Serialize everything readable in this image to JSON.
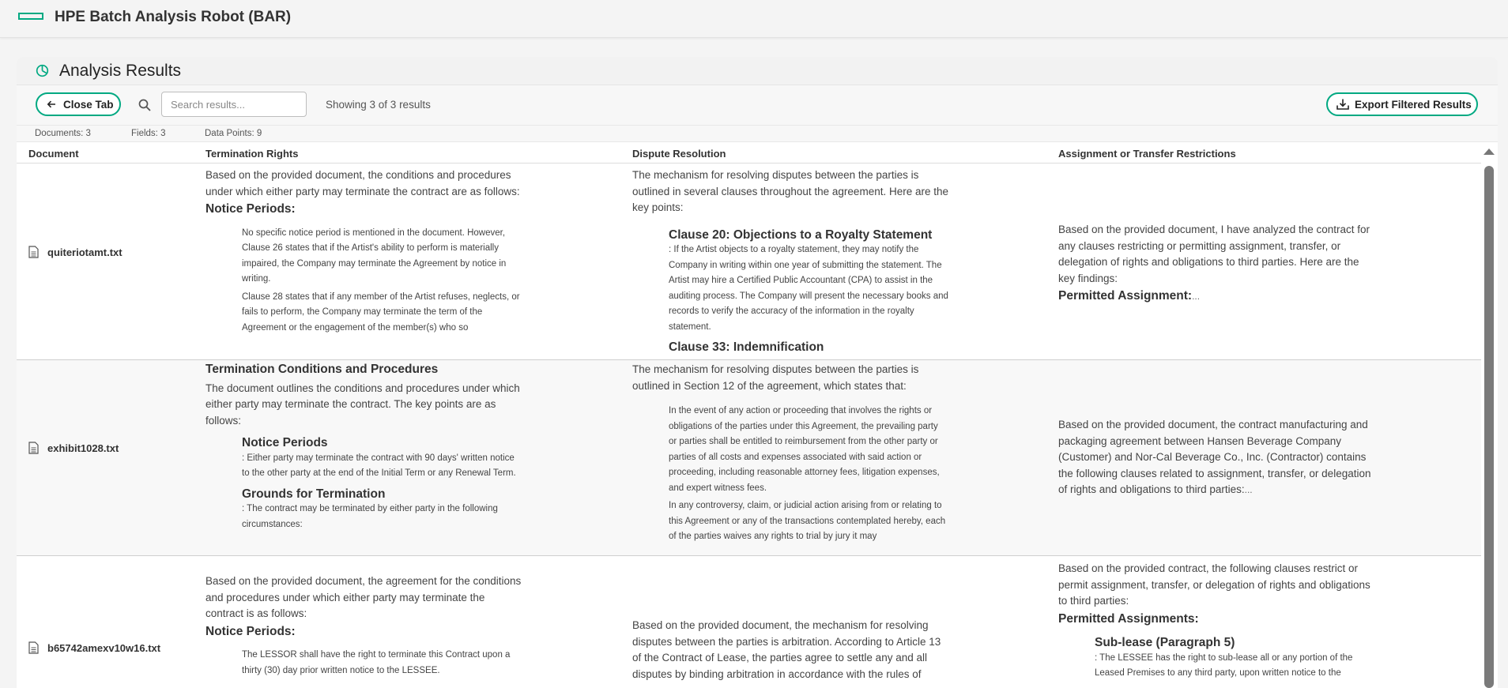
{
  "app": {
    "title": "HPE Batch Analysis Robot (BAR)",
    "accent": "#01a982"
  },
  "panel": {
    "title": "Analysis Results"
  },
  "toolbar": {
    "close_label": "Close Tab",
    "search_placeholder": "Search results...",
    "showing": "Showing 3 of 3 results",
    "export_label": "Export Filtered Results"
  },
  "stats": {
    "documents": "Documents: 3",
    "fields": "Fields: 3",
    "data_points": "Data Points: 9"
  },
  "table": {
    "headers": [
      "Document",
      "Termination Rights",
      "Dispute Resolution",
      "Assignment or Transfer Restrictions"
    ],
    "rows": [
      {
        "document": "quiteriotamt.txt",
        "termination": {
          "intro": "Based on the provided document, the conditions and procedures under which either party may terminate the contract are as follows:",
          "heading": "Notice Periods:",
          "p1": "No specific notice period is mentioned in the document. However, Clause 26 states that if the Artist's ability to perform is materially impaired, the Company may terminate the Agreement by notice in writing.",
          "p2": "Clause 28 states that if any member of the Artist refuses, neglects, or fails to perform, the Company may terminate the term of the Agreement or the engagement of the member(s) who so"
        },
        "dispute": {
          "intro": "The mechanism for resolving disputes between the parties is outlined in several clauses throughout the agreement. Here are the key points:",
          "heading1": "Clause 20: Objections to a Royalty Statement",
          "p1": ": If the Artist objects to a royalty statement, they may notify the Company in writing within one year of submitting the statement. The Artist may hire a Certified Public Accountant (CPA) to assist in the auditing process. The Company will present the necessary books and records to verify the accuracy of the information in the royalty statement.",
          "heading2": "Clause 33: Indemnification"
        },
        "assignment": {
          "intro": "Based on the provided document, I have analyzed the contract for any clauses restricting or permitting assignment, transfer, or delegation of rights and obligations to third parties. Here are the key findings:",
          "heading": "Permitted Assignment:",
          "more": "..."
        }
      },
      {
        "document": "exhibit1028.txt",
        "termination": {
          "heading": "Termination Conditions and Procedures",
          "intro": "The document outlines the conditions and procedures under which either party may terminate the contract. The key points are as follows:",
          "sub1_heading": "Notice Periods",
          "sub1": ": Either party may terminate the contract with 90 days' written notice to the other party at the end of the Initial Term or any Renewal Term.",
          "sub2_heading": "Grounds for Termination",
          "sub2": ": The contract may be terminated by either party in the following circumstances:"
        },
        "dispute": {
          "intro": "The mechanism for resolving disputes between the parties is outlined in Section 12 of the agreement, which states that:",
          "p1": "In the event of any action or proceeding that involves the rights or obligations of the parties under this Agreement, the prevailing party or parties shall be entitled to reimbursement from the other party or parties of all costs and expenses associated with said action or proceeding, including reasonable attorney fees, litigation expenses, and expert witness fees.",
          "p2": "In any controversy, claim, or judicial action arising from or relating to this Agreement or any of the transactions contemplated hereby, each of the parties waives any rights to trial by jury it may"
        },
        "assignment": {
          "intro": "Based on the provided document, the contract manufacturing and packaging agreement between Hansen Beverage Company (Customer) and Nor-Cal Beverage Co., Inc. (Contractor) contains the following clauses related to assignment, transfer, or delegation of rights and obligations to third parties:",
          "more": "..."
        }
      },
      {
        "document": "b65742amexv10w16.txt",
        "termination": {
          "intro": "Based on the provided document, the agreement for the conditions and procedures under which either party may terminate the contract is as follows:",
          "heading": "Notice Periods:",
          "p1": "The LESSOR shall have the right to terminate this Contract upon a thirty (30) day prior written notice to the LESSEE."
        },
        "dispute": {
          "intro": "Based on the provided document, the mechanism for resolving disputes between the parties is arbitration. According to Article 13 of the Contract of Lease, the parties agree to settle any and all disputes by binding arbitration in accordance with the rules of"
        },
        "assignment": {
          "intro": "Based on the provided contract, the following clauses restrict or permit assignment, transfer, or delegation of rights and obligations to third parties:",
          "heading": "Permitted Assignments:",
          "sub_heading": "Sub-lease (Paragraph 5)",
          "sub": ": The LESSEE has the right to sub-lease all or any portion of the Leased Premises to any third party, upon written notice to the"
        }
      }
    ]
  }
}
